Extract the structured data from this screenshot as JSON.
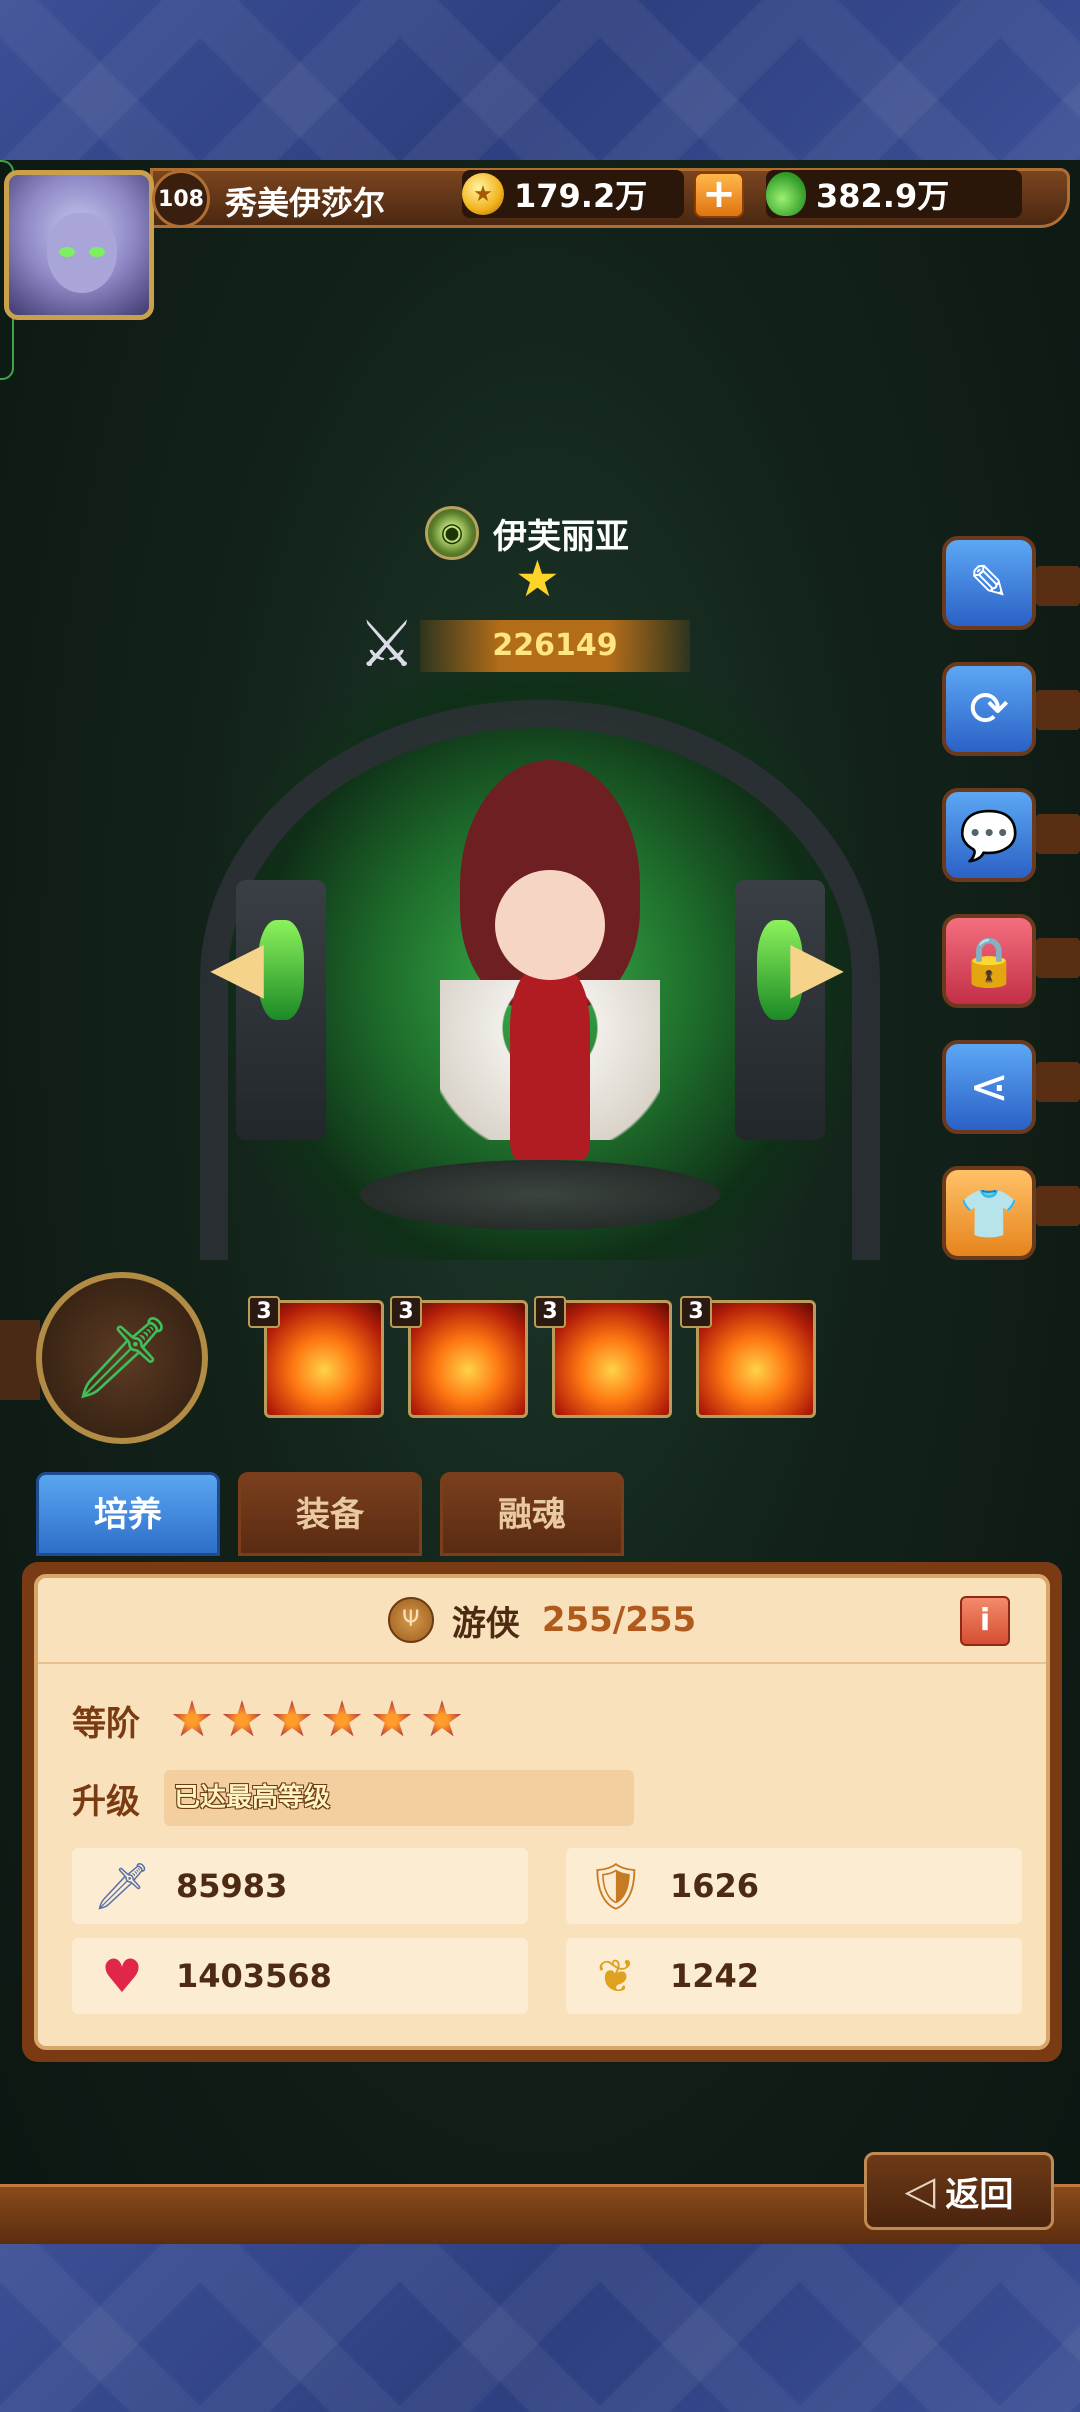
{
  "player": {
    "level": "108",
    "name": "秀美伊莎尔",
    "gold": "179.2万",
    "potion": "382.9万"
  },
  "hero": {
    "name": "伊芙丽亚",
    "power": "226149",
    "stars": 1
  },
  "skills": [
    {
      "level": "3",
      "icon": "fire-burst-icon"
    },
    {
      "level": "3",
      "icon": "flame-beast-icon"
    },
    {
      "level": "3",
      "icon": "fire-blade-icon"
    },
    {
      "level": "3",
      "icon": "fire-swirl-icon"
    }
  ],
  "tabs": [
    "培养",
    "装备",
    "融魂"
  ],
  "panel": {
    "class_name": "游侠",
    "class_level": "255/255",
    "rank_label": "等阶",
    "rank_stars": 6,
    "upgrade_label": "升级",
    "upgrade_value": "已达最高等级",
    "stats": {
      "attack": "85983",
      "defense": "1626",
      "hp": "1403568",
      "speed": "1242"
    }
  },
  "back_label": "返回",
  "colors": {
    "accent_blue": "#2e6ec9",
    "panel_bg": "#f8e1bb",
    "frame_brown": "#7a3a14"
  }
}
